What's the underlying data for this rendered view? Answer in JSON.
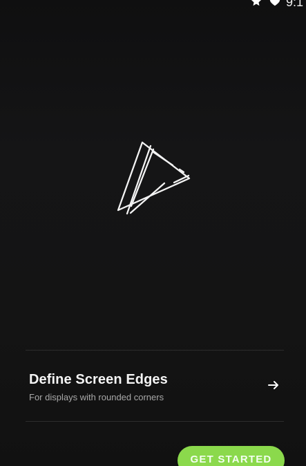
{
  "status_bar": {
    "time": "9:1",
    "icons": [
      "star-icon",
      "heart-icon"
    ]
  },
  "logo": {
    "icon": "edge-logo-icon"
  },
  "settings_row": {
    "title": "Define Screen Edges",
    "subtitle": "For displays with rounded corners",
    "icon": "arrow-right-icon"
  },
  "actions": {
    "get_started_label": "GET STARTED"
  },
  "colors": {
    "background": "#141414",
    "divider": "#2c2c2c",
    "accent": "#8bd94c",
    "primary_text": "#f5f5f5",
    "secondary_text": "#a8a8a8"
  }
}
